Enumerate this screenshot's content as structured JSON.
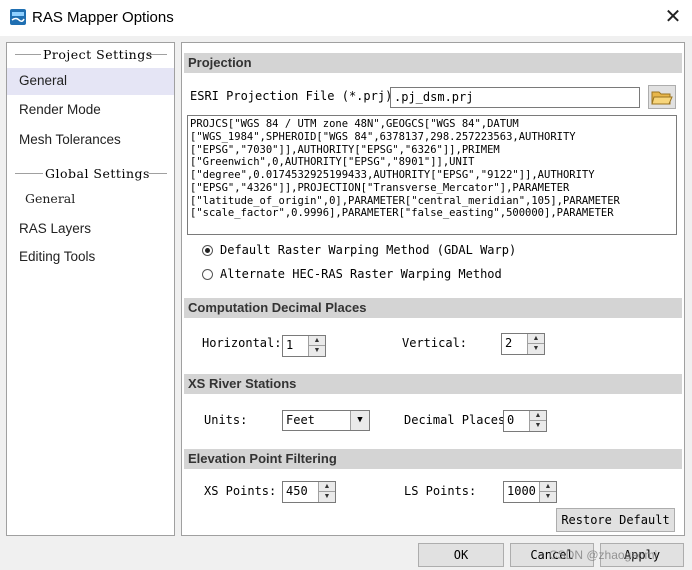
{
  "window": {
    "title": "RAS Mapper Options",
    "close_symbol": "✕"
  },
  "sidebar": {
    "project_header": "Project Settings",
    "project_items": [
      "General",
      "Render Mode",
      "Mesh Tolerances"
    ],
    "global_header": "Global Settings",
    "global_items": [
      "General",
      "RAS Layers",
      "Editing Tools"
    ],
    "selected_item": "General"
  },
  "projection": {
    "header": "Projection",
    "file_label": "ESRI Projection File (*.prj):",
    "file_value": ".pj_dsm.prj",
    "wkt_lines": [
      "PROJCS[\"WGS 84 / UTM zone 48N\",GEOGCS[\"WGS 84\",DATUM",
      "[\"WGS_1984\",SPHEROID[\"WGS 84\",6378137,298.257223563,AUTHORITY",
      "[\"EPSG\",\"7030\"]],AUTHORITY[\"EPSG\",\"6326\"]],PRIMEM",
      "[\"Greenwich\",0,AUTHORITY[\"EPSG\",\"8901\"]],UNIT",
      "[\"degree\",0.0174532925199433,AUTHORITY[\"EPSG\",\"9122\"]],AUTHORITY",
      "[\"EPSG\",\"4326\"]],PROJECTION[\"Transverse_Mercator\"],PARAMETER",
      "[\"latitude_of_origin\",0],PARAMETER[\"central_meridian\",105],PARAMETER",
      "[\"scale_factor\",0.9996],PARAMETER[\"false_easting\",500000],PARAMETER"
    ],
    "radio_default": "Default Raster Warping Method (GDAL Warp)",
    "radio_alternate": "Alternate HEC-RAS Raster Warping Method",
    "selected_method": "default"
  },
  "computation": {
    "header": "Computation Decimal Places",
    "horizontal_label": "Horizontal:",
    "horizontal_value": "1",
    "vertical_label": "Vertical:",
    "vertical_value": "2"
  },
  "xs": {
    "header": "XS River Stations",
    "units_label": "Units:",
    "units_value": "Feet",
    "decimal_label": "Decimal Places:",
    "decimal_value": "0"
  },
  "elevation": {
    "header": "Elevation Point Filtering",
    "xs_label": "XS Points:",
    "xs_value": "450",
    "ls_label": "LS Points:",
    "ls_value": "1000",
    "restore_label": "Restore Default"
  },
  "footer": {
    "ok_label": "OK",
    "cancel_label": "Cancel",
    "apply_label": "Apply",
    "watermark": "CSDN @zhaogaomi"
  },
  "colors": {
    "selected_bg": "#e5e5f5",
    "section_header": "#d4d4d4"
  }
}
